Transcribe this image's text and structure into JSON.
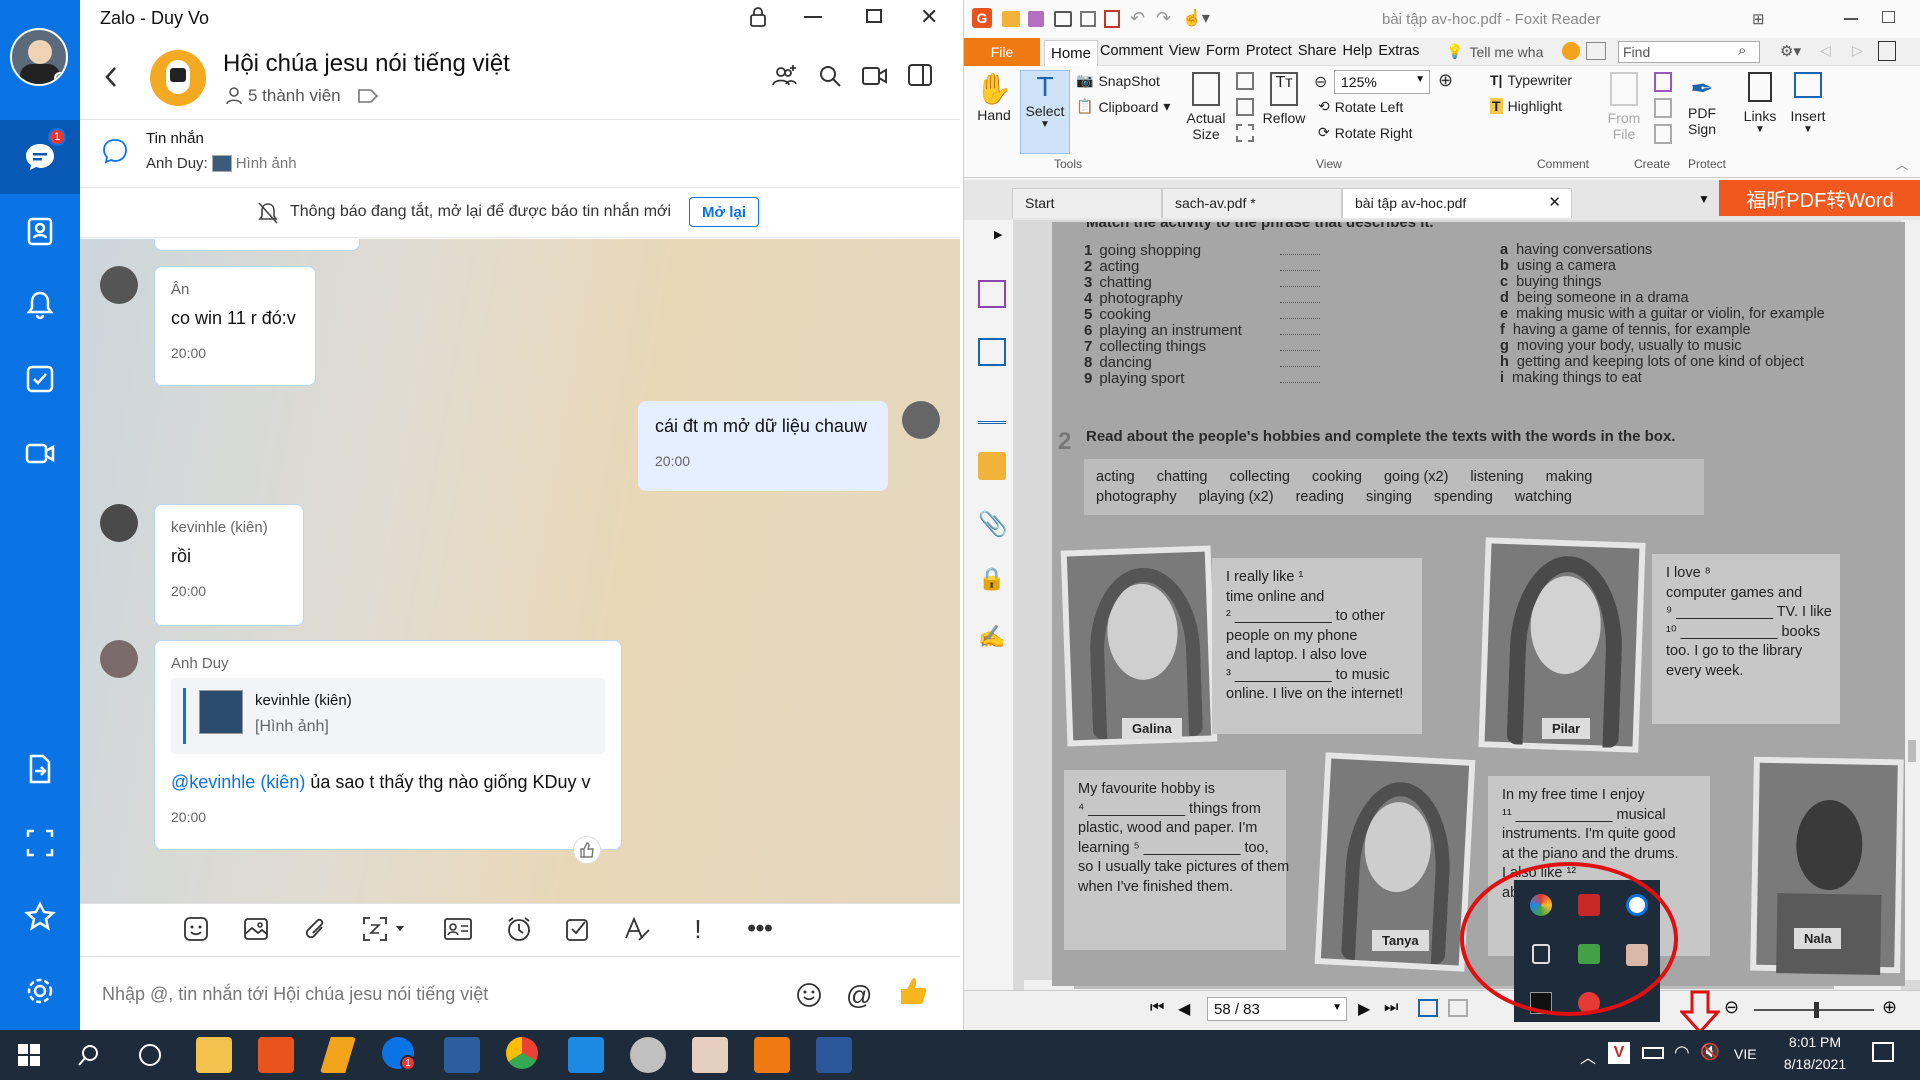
{
  "zalo": {
    "window_title": "Zalo - Duy Vo",
    "nav": {
      "chat_badge": "1"
    },
    "header": {
      "group_name": "Hội chúa jesu nói tiếng việt",
      "members": "5 thành viên"
    },
    "pinned": {
      "title": "Tin nhắn",
      "sender": "Anh Duy:",
      "preview": "Hình ảnh"
    },
    "notice": {
      "text": "Thông báo đang tắt, mở lại để được báo tin nhắn mới",
      "button": "Mở lại"
    },
    "messages": [
      {
        "name": "Ân",
        "text": "co win 11 r đó:v",
        "time": "20:00"
      },
      {
        "text": "cái đt m mở dữ liệu chauw",
        "time": "20:00"
      },
      {
        "name": "kevinhle (kiên)",
        "text": "rồi",
        "time": "20:00"
      },
      {
        "name": "Anh Duy",
        "quote_name": "kevinhle (kiên)",
        "quote_text": "[Hình ảnh]",
        "mention": "@kevinhle (kiên)",
        "text": " ủa sao t thấy thg nào giống KDuy v",
        "time": "20:00"
      }
    ],
    "input_placeholder": "Nhập @, tin nhắn tới Hội chúa jesu nói tiếng việt"
  },
  "foxit": {
    "title": "bài tập av-hoc.pdf - Foxit Reader",
    "menu": [
      "File",
      "Home",
      "Comment",
      "View",
      "Form",
      "Protect",
      "Share",
      "Help",
      "Extras"
    ],
    "tell_me": "Tell me wha",
    "find_placeholder": "Find",
    "ribbon": {
      "hand": "Hand",
      "select": "Select",
      "snapshot": "SnapShot",
      "clipboard": "Clipboard",
      "actual_size_1": "Actual",
      "actual_size_2": "Size",
      "reflow": "Reflow",
      "zoom": "125%",
      "rotate_left": "Rotate Left",
      "rotate_right": "Rotate Right",
      "typewriter": "Typewriter",
      "highlight": "Highlight",
      "from_file_1": "From",
      "from_file_2": "File",
      "pdf_sign_1": "PDF",
      "pdf_sign_2": "Sign",
      "links": "Links",
      "insert": "Insert",
      "groups": {
        "tools": "Tools",
        "view": "View",
        "comment": "Comment",
        "create": "Create",
        "protect": "Protect"
      }
    },
    "tabs": [
      "Start",
      "sach-av.pdf *",
      "bài tập av-hoc.pdf"
    ],
    "promo": "福昕PDF转Word",
    "page_nav": "58 / 83",
    "pdf": {
      "ex1_title": "Match the activity to the phrase that describes it.",
      "ex1_left": [
        "going shopping",
        "acting",
        "chatting",
        "photography",
        "cooking",
        "playing an instrument",
        "collecting things",
        "dancing",
        "playing sport"
      ],
      "ex1_right": [
        "having conversations",
        "using a camera",
        "buying things",
        "being someone in a drama",
        "making music with a guitar or violin, for example",
        "having a game of tennis, for example",
        "moving your body, usually to music",
        "getting and keeping lots of one kind of object",
        "making things to eat"
      ],
      "ex1_letters": [
        "a",
        "b",
        "c",
        "d",
        "e",
        "f",
        "g",
        "h",
        "i"
      ],
      "ex2_num": "2",
      "ex2_title": "Read about the people's hobbies and complete the texts with the words in the box.",
      "box_row1": [
        "acting",
        "chatting",
        "collecting",
        "cooking",
        "going (x2)",
        "listening",
        "making"
      ],
      "box_row2": [
        "photography",
        "playing (x2)",
        "reading",
        "singing",
        "spending",
        "watching"
      ],
      "galina_text": [
        "I really like ¹",
        "time online and",
        "² ____________ to other",
        "people on my phone",
        "and laptop. I also love",
        "³ ____________ to music",
        "online. I live on the internet!"
      ],
      "pilar_text": [
        "I love ⁸",
        "computer games and",
        "⁹ ____________ TV. I like",
        "¹⁰ ____________ books",
        "too. I go to the library",
        "every week."
      ],
      "tanya_text": [
        "My favourite hobby is",
        "⁴ ____________ things from",
        "plastic, wood and paper. I'm",
        "learning ⁵ ____________ too,",
        "so I usually take pictures of them",
        "when I've finished them."
      ],
      "nala_text": [
        "In my free time I enjoy",
        "¹¹ ____________ musical",
        "instruments. I'm quite good",
        "at the piano and the drums.",
        "I also like ¹²",
        "about 30"
      ],
      "names": {
        "galina": "Galina",
        "pilar": "Pilar",
        "tanya": "Tanya",
        "nala": "Nala"
      }
    }
  },
  "taskbar": {
    "lang": "VIE",
    "time": "8:01 PM",
    "date": "8/18/2021"
  }
}
